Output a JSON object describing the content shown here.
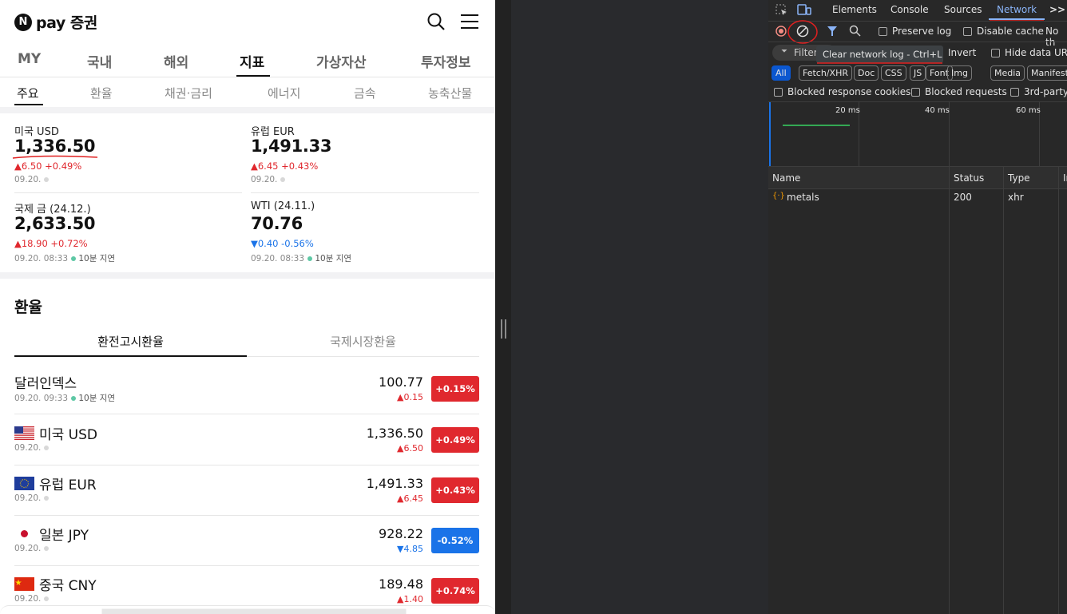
{
  "app": {
    "logo_letter": "N",
    "logo_text": "pay 증권"
  },
  "main_tabs": [
    "MY",
    "국내",
    "해외",
    "지표",
    "가상자산",
    "투자정보"
  ],
  "sub_tabs": [
    "주요",
    "환율",
    "채권·금리",
    "에너지",
    "금속",
    "농축산물"
  ],
  "summary": [
    {
      "label": "미국 USD",
      "value": "1,336.50",
      "change": "▲6.50  +0.49%",
      "dir": "up",
      "date": "09.20."
    },
    {
      "label": "유럽 EUR",
      "value": "1,491.33",
      "change": "▲6.45  +0.43%",
      "dir": "up",
      "date": "09.20."
    },
    {
      "label": "국제 금 (24.12.)",
      "value": "2,633.50",
      "change": "▲18.90  +0.72%",
      "dir": "up",
      "date": "09.20. 08:33",
      "delay": "10분 지연"
    },
    {
      "label": "WTI (24.11.)",
      "value": "70.76",
      "change": "▼0.40  -0.56%",
      "dir": "down",
      "date": "09.20. 08:33",
      "delay": "10분 지연"
    }
  ],
  "fx": {
    "title": "환율",
    "tabs": [
      "환전고시환율",
      "국제시장환율"
    ],
    "rows": [
      {
        "name": "달러인덱스",
        "flag": "",
        "date": "09.20. 09:33",
        "delay": "10분 지연",
        "value": "100.77",
        "change": "▲0.15",
        "pct": "+0.15%",
        "dir": "up"
      },
      {
        "name": "미국 USD",
        "flag": "us-flag-icon",
        "date": "09.20.",
        "value": "1,336.50",
        "change": "▲6.50",
        "pct": "+0.49%",
        "dir": "up"
      },
      {
        "name": "유럽 EUR",
        "flag": "eu-flag-icon",
        "date": "09.20.",
        "value": "1,491.33",
        "change": "▲6.45",
        "pct": "+0.43%",
        "dir": "up"
      },
      {
        "name": "일본 JPY",
        "flag": "jp-flag-icon",
        "date": "09.20.",
        "value": "928.22",
        "change": "▼4.85",
        "pct": "-0.52%",
        "dir": "down"
      },
      {
        "name": "중국 CNY",
        "flag": "cn-flag-icon",
        "date": "09.20.",
        "value": "189.48",
        "change": "▲1.40",
        "pct": "+0.74%",
        "dir": "up"
      }
    ]
  },
  "devtools": {
    "tabs": [
      "Elements",
      "Console",
      "Sources",
      "Network"
    ],
    "active_tab": "Network",
    "more": ">>",
    "preserve_log": "Preserve log",
    "disable_cache": "Disable cache",
    "throttle": "No th",
    "tooltip": "Clear network log - Ctrl+L",
    "filter_placeholder": "Filter",
    "invert": "Invert",
    "hide_data": "Hide data URL",
    "chips": [
      "All",
      "Fetch/XHR",
      "Doc",
      "CSS",
      "JS",
      "Font",
      "Img",
      "Media",
      "Manifest"
    ],
    "blocked_cookies": "Blocked response cookies",
    "blocked_requests": "Blocked requests",
    "third_party": "3rd-party",
    "timeline": [
      "20 ms",
      "40 ms",
      "60 ms"
    ],
    "columns": [
      "Name",
      "Status",
      "Type",
      "Ir"
    ],
    "requests": [
      {
        "name": "metals",
        "status": "200",
        "type": "xhr"
      }
    ],
    "colors": {
      "accent": "#8ab4f8",
      "annotation": "#e02020",
      "up": "#e0282e",
      "down": "#1a73e8"
    }
  }
}
